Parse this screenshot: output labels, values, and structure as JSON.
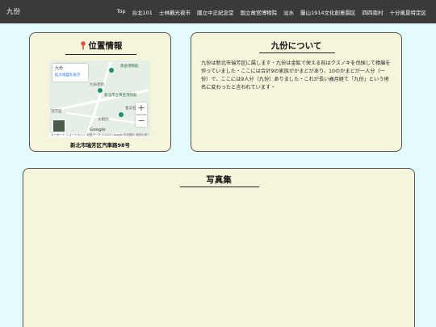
{
  "nav": {
    "brand": "九份",
    "links": [
      "Top",
      "台北101",
      "士林觀光夜市",
      "國立中正紀念堂",
      "国立故宮博物院",
      "淡水",
      "蘭山1914文化創意園区",
      "四四南村",
      "十分風景特定区"
    ]
  },
  "location": {
    "title": "位置情報",
    "pin_icon": "map-pin-icon",
    "address": "新北市瑞芳区汽車路98号",
    "map": {
      "info_title": "九份",
      "info_link": "拡大地図を表示",
      "zoom_in": "+",
      "zoom_out": "−",
      "labels": {
        "museum": "黄金博物館",
        "shinbashi": "九份老街",
        "school": "新北市立黄金博物館",
        "area1": "金瓜石",
        "area2": "大粗坑",
        "area3": "瑞芳區"
      },
      "attribution": "キーボード ショートカット   地図データ ©2023 Google   利用規約   地図の誤りを報告する",
      "google": "Google"
    }
  },
  "about": {
    "title": "九份について",
    "text": "九份は新北市瑞芳区に属します・九份は金鉱で栄える前はクスノキを伐採して樟脳を作っていました・ここには合計9の家族がかまどがあり、10のかまどが一人分（一份）で、ここには9人分（九份）ありました・これが長い歳月経て「九份」という地名に変わったと言われています・"
  },
  "gallery": {
    "title": "写真集"
  }
}
